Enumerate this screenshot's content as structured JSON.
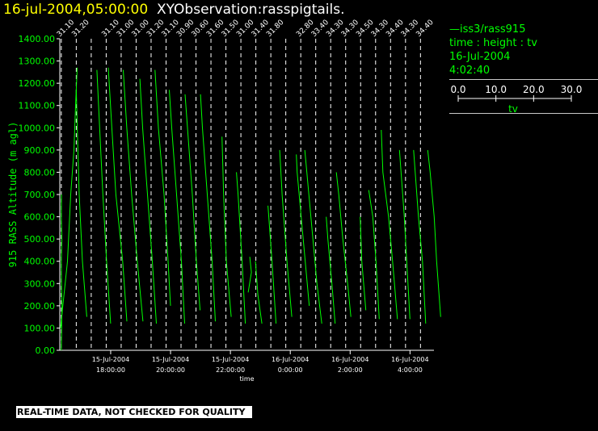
{
  "header": {
    "date": "16-jul-2004,05:00:00",
    "title": "XYObservation:rasspigtails."
  },
  "legend": {
    "series": "iss3/rass915",
    "variables": "time : height : tv",
    "date": "16-Jul-2004",
    "time": "4:02:40",
    "scale_ticks": [
      "0.0",
      "10.0",
      "20.0",
      "30.0"
    ],
    "scale_label": "tv"
  },
  "notice": "REAL-TIME DATA, NOT CHECKED FOR QUALITY",
  "colors": {
    "background": "#000000",
    "series": "#00ff00",
    "axis": "#ffffff"
  },
  "chart_data": {
    "type": "line",
    "title": "",
    "xlabel": "time",
    "ylabel": "915 RASS Altitude (m agl)",
    "ylim": [
      0,
      1400
    ],
    "xlim_hours": [
      16.3,
      28.8
    ],
    "grid": false,
    "y_ticks": [
      "0.00",
      "100.00",
      "200.00",
      "300.00",
      "400.00",
      "500.00",
      "600.00",
      "700.00",
      "800.00",
      "900.00",
      "1000.00",
      "1100.00",
      "1200.00",
      "1300.00",
      "1400.00"
    ],
    "x_ticks": [
      {
        "t": 18,
        "date": "15-Jul-2004",
        "time": "18:00:00"
      },
      {
        "t": 20,
        "date": "15-Jul-2004",
        "time": "20:00:00"
      },
      {
        "t": 22,
        "date": "15-Jul-2004",
        "time": "22:00:00"
      },
      {
        "t": 24,
        "date": "16-Jul-2004",
        "time": "0:00:00"
      },
      {
        "t": 26,
        "date": "16-Jul-2004",
        "time": "2:00:00"
      },
      {
        "t": 28,
        "date": "16-Jul-2004",
        "time": "4:00:00"
      }
    ],
    "profiles": [
      {
        "t": 16.35,
        "label": "31.10",
        "points": [
          [
            0,
            0.0
          ],
          [
            100,
            0.2
          ],
          [
            200,
            0.4
          ],
          [
            300,
            0.1
          ],
          [
            400,
            0.0
          ],
          [
            500,
            0.3
          ],
          [
            600,
            0.0
          ],
          [
            700,
            0.1
          ]
        ]
      },
      {
        "t": 16.35,
        "label": "",
        "points": [
          [
            100,
            -0.5
          ],
          [
            400,
            3.8
          ],
          [
            700,
            5.8
          ],
          [
            900,
            7.8
          ],
          [
            1100,
            8.8
          ],
          [
            1270,
            9.8
          ]
        ]
      },
      {
        "t": 16.85,
        "label": "31.20",
        "points": [
          [
            150,
            6.5
          ],
          [
            400,
            3.8
          ],
          [
            700,
            1.8
          ],
          [
            1000,
            0.6
          ],
          [
            1170,
            0.0
          ]
        ]
      },
      {
        "t": 17.35,
        "label": "",
        "points": [
          [
            120,
            12.0
          ],
          [
            400,
            9.5
          ],
          [
            700,
            7.2
          ],
          [
            1000,
            5.2
          ],
          [
            1260,
            3.5
          ]
        ]
      },
      {
        "t": 17.85,
        "label": "31.10",
        "points": [
          [
            130,
            12.8
          ],
          [
            400,
            10.2
          ],
          [
            700,
            6.0
          ],
          [
            1000,
            3.5
          ],
          [
            1270,
            1.3
          ]
        ]
      },
      {
        "t": 18.35,
        "label": "31.00",
        "points": [
          [
            130,
            13.5
          ],
          [
            400,
            10.0
          ],
          [
            700,
            6.5
          ],
          [
            1000,
            3.5
          ],
          [
            1260,
            1.3
          ]
        ]
      },
      {
        "t": 18.85,
        "label": "31.00",
        "points": [
          [
            120,
            12.5
          ],
          [
            400,
            10.0
          ],
          [
            700,
            7.0
          ],
          [
            1000,
            4.0
          ],
          [
            1220,
            2.3
          ]
        ]
      },
      {
        "t": 19.35,
        "label": "31.20",
        "points": [
          [
            200,
            12.0
          ],
          [
            400,
            10.5
          ],
          [
            700,
            8.0
          ],
          [
            1000,
            4.5
          ],
          [
            1260,
            2.4
          ]
        ]
      },
      {
        "t": 19.85,
        "label": "31.10",
        "points": [
          [
            120,
            11.5
          ],
          [
            400,
            9.5
          ],
          [
            700,
            6.5
          ],
          [
            1000,
            3.5
          ],
          [
            1170,
            2.0
          ]
        ]
      },
      {
        "t": 20.35,
        "label": "30.90",
        "points": [
          [
            180,
            11.8
          ],
          [
            400,
            9.5
          ],
          [
            700,
            7.0
          ],
          [
            1000,
            4.0
          ],
          [
            1150,
            2.5
          ]
        ]
      },
      {
        "t": 20.85,
        "label": "30.60",
        "points": [
          [
            130,
            12.0
          ],
          [
            400,
            10.0
          ],
          [
            700,
            7.0
          ],
          [
            1000,
            4.0
          ],
          [
            1150,
            2.8
          ]
        ]
      },
      {
        "t": 21.35,
        "label": "31.60",
        "points": [
          [
            150,
            12.5
          ],
          [
            400,
            9.5
          ],
          [
            700,
            7.8
          ],
          [
            960,
            6.8
          ]
        ]
      },
      {
        "t": 21.85,
        "label": "31.50",
        "points": [
          [
            120,
            12.0
          ],
          [
            400,
            10.0
          ],
          [
            700,
            7.5
          ],
          [
            800,
            6.5
          ]
        ]
      },
      {
        "t": 22.35,
        "label": "31.00",
        "points": [
          [
            120,
            13.0
          ],
          [
            250,
            10.5
          ],
          [
            400,
            9.0
          ]
        ]
      },
      {
        "t": 22.35,
        "label": "",
        "points": [
          [
            260,
            4.5
          ],
          [
            350,
            6.5
          ],
          [
            420,
            5.5
          ]
        ]
      },
      {
        "t": 22.85,
        "label": "31.40",
        "points": [
          [
            120,
            12.5
          ],
          [
            400,
            10.0
          ],
          [
            650,
            7.5
          ]
        ]
      },
      {
        "t": 23.35,
        "label": "31.80",
        "points": [
          [
            150,
            13.0
          ],
          [
            400,
            10.0
          ],
          [
            700,
            7.0
          ],
          [
            900,
            5.5
          ]
        ]
      },
      {
        "t": 23.85,
        "label": "",
        "points": [
          [
            200,
            14.5
          ],
          [
            400,
            12.0
          ],
          [
            600,
            9.5
          ],
          [
            800,
            7.0
          ],
          [
            880,
            6.5
          ]
        ]
      },
      {
        "t": 24.35,
        "label": "32.80",
        "points": [
          [
            120,
            13.0
          ],
          [
            300,
            10.0
          ],
          [
            500,
            7.5
          ],
          [
            700,
            5.0
          ],
          [
            900,
            2.5
          ]
        ]
      },
      {
        "t": 24.85,
        "label": "33.40",
        "points": [
          [
            120,
            12.0
          ],
          [
            300,
            10.0
          ],
          [
            500,
            7.5
          ],
          [
            600,
            6.5
          ]
        ]
      },
      {
        "t": 25.35,
        "label": "34.30",
        "points": [
          [
            150,
            12.5
          ],
          [
            300,
            10.5
          ],
          [
            500,
            7.5
          ],
          [
            700,
            5.0
          ],
          [
            800,
            3.5
          ]
        ]
      },
      {
        "t": 25.85,
        "label": "34.30",
        "points": [
          [
            180,
            12.5
          ],
          [
            400,
            10.0
          ],
          [
            600,
            9.0
          ]
        ]
      },
      {
        "t": 26.35,
        "label": "34.50",
        "points": [
          [
            140,
            11.5
          ],
          [
            400,
            9.5
          ],
          [
            600,
            7.5
          ],
          [
            720,
            5.0
          ]
        ]
      },
      {
        "t": 26.85,
        "label": "34.30",
        "points": [
          [
            140,
            13.5
          ],
          [
            400,
            10.5
          ],
          [
            600,
            8.0
          ],
          [
            800,
            4.5
          ],
          [
            990,
            3.5
          ]
        ]
      },
      {
        "t": 27.35,
        "label": "34.40",
        "points": [
          [
            140,
            12.0
          ],
          [
            400,
            10.0
          ],
          [
            600,
            8.5
          ],
          [
            800,
            6.5
          ],
          [
            900,
            5.5
          ]
        ]
      },
      {
        "t": 27.85,
        "label": "34.30",
        "points": [
          [
            120,
            12.5
          ],
          [
            400,
            10.5
          ],
          [
            600,
            8.0
          ],
          [
            800,
            6.0
          ],
          [
            900,
            5.0
          ]
        ]
      },
      {
        "t": 28.35,
        "label": "34.40",
        "points": [
          [
            150,
            12.5
          ],
          [
            400,
            10.0
          ],
          [
            600,
            8.5
          ],
          [
            800,
            6.0
          ],
          [
            900,
            4.5
          ]
        ]
      }
    ]
  }
}
